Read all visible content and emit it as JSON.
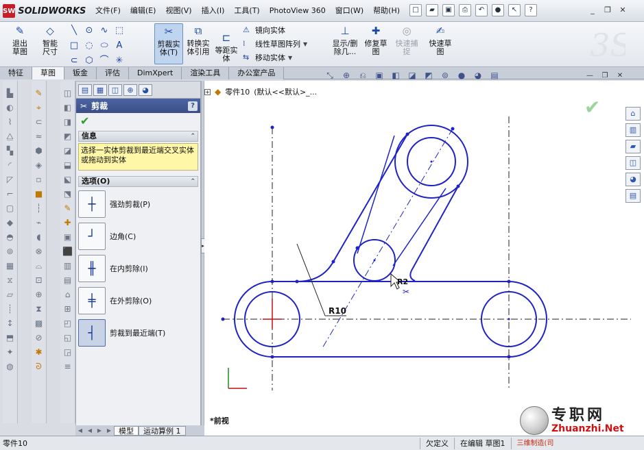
{
  "app": {
    "logo_mark": "SW",
    "logo_text": "SOLIDWORKS"
  },
  "menu": [
    "文件(F)",
    "编辑(E)",
    "视图(V)",
    "插入(I)",
    "工具(T)",
    "PhotoView 360",
    "窗口(W)",
    "帮助(H)"
  ],
  "quick_access": [
    "new-icon",
    "open-icon",
    "save-icon",
    "print-icon",
    "undo-icon",
    "rebuild-icon",
    "select-icon",
    "help-icon"
  ],
  "window_controls": [
    "_",
    "❐",
    "✕"
  ],
  "commands": {
    "exit_sketch": "退出草图",
    "smart_dim": "智能尺寸",
    "trim": "剪裁实体(T)",
    "convert": "转换实体引用",
    "offset": "等距实体",
    "mirror": "镜向实体",
    "linear_pattern": "线性草图阵列",
    "move": "移动实体",
    "show_delete": "显示/删除几...",
    "repair": "修复草图",
    "quick_snap": "快速捕捉",
    "rapid_sketch": "快速草图"
  },
  "tabs": [
    "特征",
    "草图",
    "钣金",
    "评估",
    "DimXpert",
    "渲染工具",
    "办公室产品"
  ],
  "active_tab": "草图",
  "pm": {
    "title": "剪裁",
    "help": "?",
    "ok": "✔",
    "info_header": "信息",
    "info_text": "选择一实体剪裁到最近端交叉实体或拖动到实体",
    "options_header": "选项(O)",
    "options": [
      {
        "label": "强劲剪裁(P)",
        "icon": "power-trim-icon",
        "selected": false
      },
      {
        "label": "边角(C)",
        "icon": "corner-trim-icon",
        "selected": false
      },
      {
        "label": "在内剪除(I)",
        "icon": "trim-inside-icon",
        "selected": false
      },
      {
        "label": "在外剪除(O)",
        "icon": "trim-outside-icon",
        "selected": false
      },
      {
        "label": "剪裁到最近端(T)",
        "icon": "trim-closest-icon",
        "selected": true
      }
    ]
  },
  "tree": {
    "part": "零件10",
    "config": "(默认<<默认>_..."
  },
  "model_tabs": [
    "模型",
    "运动算例 1"
  ],
  "view_label": "*前视",
  "sketch": {
    "dim1": "R10",
    "dim2": "R2"
  },
  "status": {
    "left": "零件10",
    "defined": "欠定义",
    "editing": "在编辑 草图1",
    "brand": "三维制造(司"
  },
  "watermark": {
    "cn": "专职网",
    "url": "Zhuanzhi.Net"
  }
}
